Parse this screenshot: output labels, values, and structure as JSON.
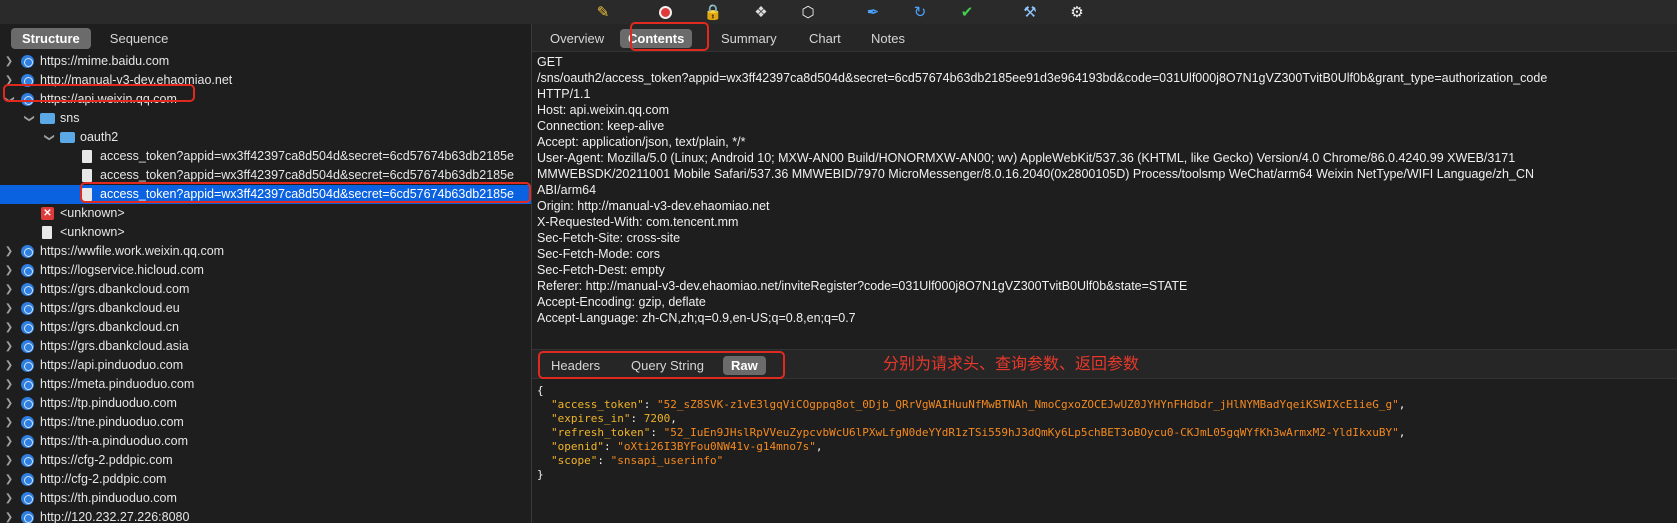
{
  "toolbar": {
    "icons": [
      "broom-icon",
      "record-icon",
      "lock-icon",
      "turtle-icon",
      "hexagon-icon",
      "pen-icon",
      "refresh-icon",
      "check-icon",
      "tools-icon",
      "gear-icon"
    ]
  },
  "left": {
    "view_tabs": [
      {
        "label": "Structure",
        "active": true
      },
      {
        "label": "Sequence",
        "active": false
      }
    ],
    "tree": [
      {
        "label": "https://mime.baidu.com"
      },
      {
        "label": "http://manual-v3-dev.ehaomiao.net"
      },
      {
        "label": "https://api.weixin.qq.com"
      },
      {
        "label": "sns"
      },
      {
        "label": "oauth2"
      },
      {
        "label": "access_token?appid=wx3ff42397ca8d504d&secret=6cd57674b63db2185e"
      },
      {
        "label": "access_token?appid=wx3ff42397ca8d504d&secret=6cd57674b63db2185e"
      },
      {
        "label": "access_token?appid=wx3ff42397ca8d504d&secret=6cd57674b63db2185e"
      },
      {
        "label": "<unknown>"
      },
      {
        "label": "<unknown>"
      },
      {
        "label": "https://wwfile.work.weixin.qq.com"
      },
      {
        "label": "https://logservice.hicloud.com"
      },
      {
        "label": "https://grs.dbankcloud.com"
      },
      {
        "label": "https://grs.dbankcloud.eu"
      },
      {
        "label": "https://grs.dbankcloud.cn"
      },
      {
        "label": "https://grs.dbankcloud.asia"
      },
      {
        "label": "https://api.pinduoduo.com"
      },
      {
        "label": "https://meta.pinduoduo.com"
      },
      {
        "label": "https://tp.pinduoduo.com"
      },
      {
        "label": "https://tne.pinduoduo.com"
      },
      {
        "label": "https://th-a.pinduoduo.com"
      },
      {
        "label": "https://cfg-2.pddpic.com"
      },
      {
        "label": "http://cfg-2.pddpic.com"
      },
      {
        "label": "https://th.pinduoduo.com"
      },
      {
        "label": "http://120.232.27.226:8080"
      }
    ]
  },
  "right": {
    "tabs": [
      {
        "label": "Overview"
      },
      {
        "label": "Contents"
      },
      {
        "label": "Summary"
      },
      {
        "label": "Chart"
      },
      {
        "label": "Notes"
      }
    ],
    "request_lines": [
      "GET",
      "/sns/oauth2/access_token?appid=wx3ff42397ca8d504d&secret=6cd57674b63db2185ee91d3e964193bd&code=031Ulf000j8O7N1gVZ300TvitB0Ulf0b&grant_type=authorization_code",
      " HTTP/1.1",
      "Host: api.weixin.qq.com",
      "Connection: keep-alive",
      "Accept: application/json, text/plain, */*",
      "User-Agent: Mozilla/5.0 (Linux; Android 10; MXW-AN00 Build/HONORMXW-AN00; wv) AppleWebKit/537.36 (KHTML, like Gecko) Version/4.0 Chrome/86.0.4240.99 XWEB/3171",
      "MMWEBSDK/20211001 Mobile Safari/537.36 MMWEBID/7970 MicroMessenger/8.0.16.2040(0x2800105D) Process/toolsmp WeChat/arm64 Weixin NetType/WIFI Language/zh_CN",
      "ABI/arm64",
      "Origin: http://manual-v3-dev.ehaomiao.net",
      "X-Requested-With: com.tencent.mm",
      "Sec-Fetch-Site: cross-site",
      "Sec-Fetch-Mode: cors",
      "Sec-Fetch-Dest: empty",
      "Referer: http://manual-v3-dev.ehaomiao.net/inviteRegister?code=031Ulf000j8O7N1gVZ300TvitB0Ulf0b&state=STATE",
      "Accept-Encoding: gzip, deflate",
      "Accept-Language: zh-CN,zh;q=0.9,en-US;q=0.8,en;q=0.7"
    ],
    "sub_tabs": [
      {
        "label": "Headers"
      },
      {
        "label": "Query String"
      },
      {
        "label": "Raw"
      }
    ],
    "annotation": "分别为请求头、查询参数、返回参数",
    "json": {
      "open": "{",
      "close": "}",
      "access_token_key": "\"access_token\"",
      "access_token_val": "\"52_sZ8SVK-z1vE3lgqViCOgppq8ot_0Djb_QRrVgWAIHuuNfMwBTNAh_NmoCgxoZOCEJwUZ0JYHYnFHdbdr_jHlNYMBadYqeiKSWIXcE1ieG_g\"",
      "expires_in_key": "\"expires_in\"",
      "expires_in_val": "7200",
      "refresh_token_key": "\"refresh_token\"",
      "refresh_token_val": "\"52_IuEn9JHslRpVVeuZypcvbWcU6lPXwLfgN0deYYdR1zTSi559hJ3dQmKy6Lp5chBET3oBOycu0-CKJmL05gqWYfKh3wArmxM2-YldIkxuBY\"",
      "openid_key": "\"openid\"",
      "openid_val": "\"oXti26I3BYFou0NW41v-g14mno7s\"",
      "scope_key": "\"scope\"",
      "scope_val": "\"snsapi_userinfo\""
    }
  }
}
